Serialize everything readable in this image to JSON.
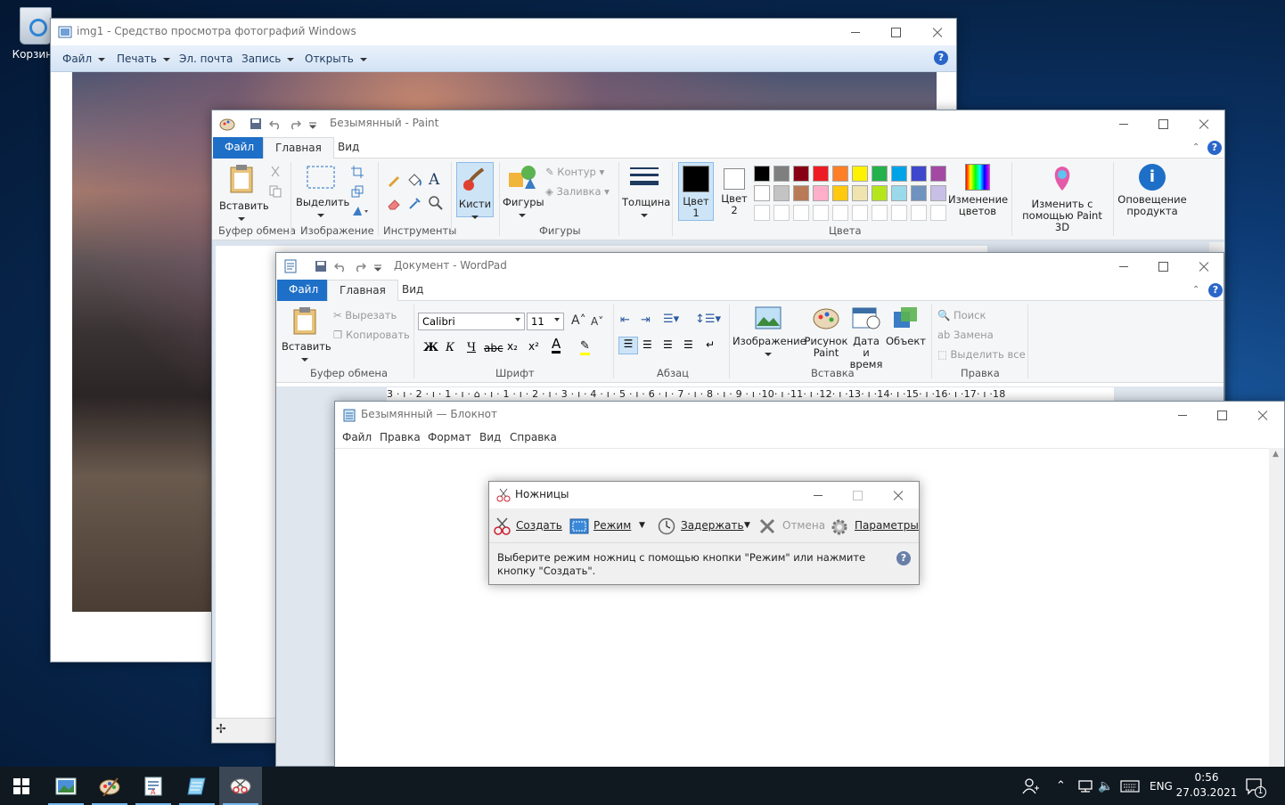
{
  "desktop": {
    "recycle_bin_label": "Корзина"
  },
  "photo_viewer": {
    "title": "img1 - Средство просмотра фотографий Windows",
    "menu": [
      "Файл",
      "Печать",
      "Эл. почта",
      "Запись",
      "Открыть"
    ]
  },
  "paint": {
    "title": "Безымянный - Paint",
    "tabs": [
      "Файл",
      "Главная",
      "Вид"
    ],
    "buttons": {
      "paste": "Вставить",
      "select": "Выделить",
      "brushes": "Кисти",
      "shapes": "Фигуры",
      "outline": "Контур",
      "fill": "Заливка",
      "size": "Толщина",
      "color1": "Цвет 1",
      "color2": "Цвет 2",
      "edit_colors": "Изменение цветов",
      "paint3d": "Изменить с помощью Paint 3D",
      "product_alert": "Оповещение продукта"
    },
    "groups": [
      "Буфер обмена",
      "Изображение",
      "Инструменты",
      "Фигуры",
      "Цвета"
    ],
    "palette_row1": [
      "#000000",
      "#7f7f7f",
      "#880015",
      "#ed1c24",
      "#ff7f27",
      "#fff200",
      "#22b14c",
      "#00a2e8",
      "#3f48cc",
      "#a349a4"
    ],
    "palette_row2": [
      "#ffffff",
      "#c3c3c3",
      "#b97a57",
      "#ffaec9",
      "#ffc90e",
      "#efe4b0",
      "#b5e61d",
      "#99d9ea",
      "#7092be",
      "#c8bfe7"
    ]
  },
  "wordpad": {
    "title": "Документ - WordPad",
    "tabs": [
      "Файл",
      "Главная",
      "Вид"
    ],
    "buttons": {
      "paste": "Вставить",
      "cut": "Вырезать",
      "copy": "Копировать",
      "font_name": "Calibri",
      "font_size": "11",
      "bold": "Ж",
      "italic": "К",
      "underline": "Ч",
      "strike": "abc",
      "picture": "Изображение",
      "paint_drawing": "Рисунок Paint",
      "datetime": "Дата и время",
      "object": "Объект",
      "find": "Поиск",
      "replace": "Замена",
      "select_all": "Выделить все"
    },
    "groups": [
      "Буфер обмена",
      "Шрифт",
      "Абзац",
      "Вставка",
      "Правка"
    ],
    "ruler": "3 · ı · 2 · ı · 1 · ı · ⌂ · ı · 1 · ı · 2 · ı · 3 · ı · 4 · ı · 5 · ı · 6 · ı · 7 · ı · 8 · ı · 9 · ı ·10· ı ·11· ı ·12· ı ·13· ı ·14· ı ·15· ı ·16· ı ·17· ı ·18"
  },
  "notepad": {
    "title": "Безымянный — Блокнот",
    "menu": [
      "Файл",
      "Правка",
      "Формат",
      "Вид",
      "Справка"
    ]
  },
  "snipping": {
    "title": "Ножницы",
    "tools": {
      "new": "Создать",
      "mode": "Режим",
      "delay": "Задержать",
      "cancel": "Отмена",
      "options": "Параметры"
    },
    "message": "Выберите режим ножниц с помощью кнопки \"Режим\" или нажмите кнопку \"Создать\"."
  },
  "taskbar": {
    "language": "ENG",
    "time": "0:56",
    "date": "27.03.2021",
    "notification_count": "1"
  }
}
